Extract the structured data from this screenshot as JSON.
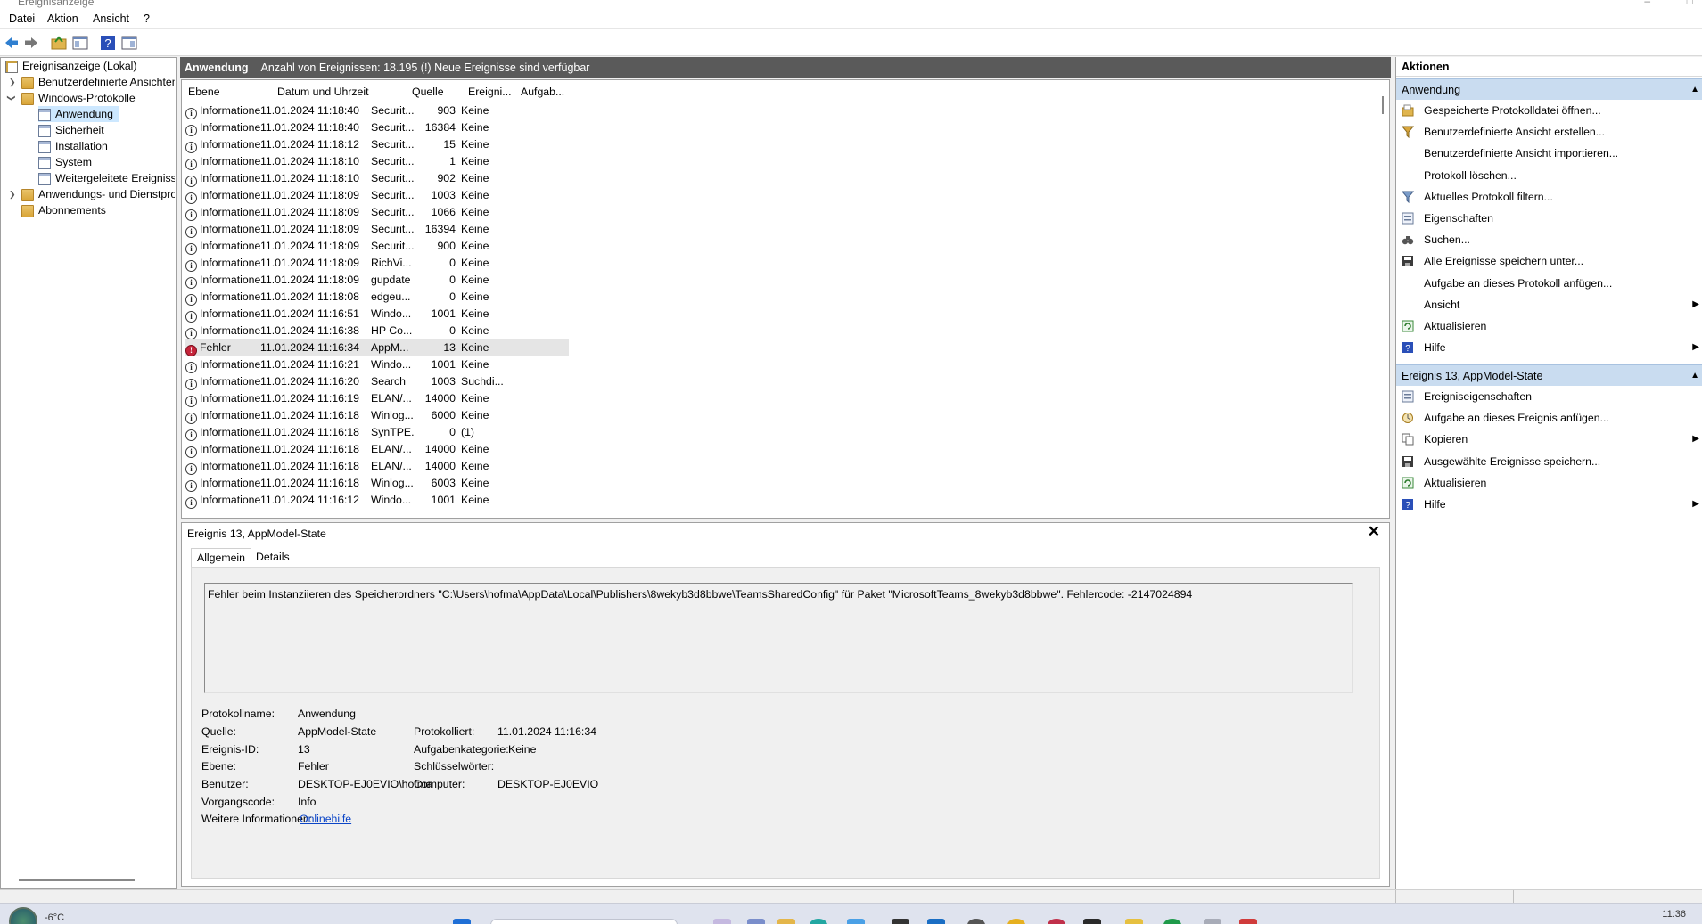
{
  "window": {
    "title": "Ereignisanzeige"
  },
  "menu": [
    "Datei",
    "Aktion",
    "Ansicht",
    "?"
  ],
  "toolbar": {
    "icons": [
      "back-arrow-icon",
      "forward-arrow-icon",
      "open-folder-icon",
      "console-tree-icon",
      "help-icon",
      "action-pane-icon"
    ]
  },
  "tree": {
    "root": "Ereignisanzeige (Lokal)",
    "items": [
      {
        "label": "Benutzerdefinierte Ansichten",
        "level": 1
      },
      {
        "label": "Windows-Protokolle",
        "level": 1
      },
      {
        "label": "Anwendung",
        "level": 2,
        "selected": true
      },
      {
        "label": "Sicherheit",
        "level": 2
      },
      {
        "label": "Installation",
        "level": 2
      },
      {
        "label": "System",
        "level": 2
      },
      {
        "label": "Weitergeleitete Ereignisse",
        "level": 2
      },
      {
        "label": "Anwendungs- und Dienstprotokolle",
        "level": 1
      },
      {
        "label": "Abonnements",
        "level": 1
      }
    ]
  },
  "log_header": {
    "name": "Anwendung",
    "info": "Anzahl von Ereignissen: 18.195 (!) Neue Ereignisse sind verfügbar"
  },
  "columns": [
    "Ebene",
    "Datum und Uhrzeit",
    "Quelle",
    "Ereigni...",
    "Aufgab..."
  ],
  "events": [
    {
      "level": "Informationen",
      "datetime": "11.01.2024 11:18:40",
      "source": "Securit...",
      "id": "903",
      "task": "Keine"
    },
    {
      "level": "Informationen",
      "datetime": "11.01.2024 11:18:40",
      "source": "Securit...",
      "id": "16384",
      "task": "Keine"
    },
    {
      "level": "Informationen",
      "datetime": "11.01.2024 11:18:12",
      "source": "Securit...",
      "id": "15",
      "task": "Keine"
    },
    {
      "level": "Informationen",
      "datetime": "11.01.2024 11:18:10",
      "source": "Securit...",
      "id": "1",
      "task": "Keine"
    },
    {
      "level": "Informationen",
      "datetime": "11.01.2024 11:18:10",
      "source": "Securit...",
      "id": "902",
      "task": "Keine"
    },
    {
      "level": "Informationen",
      "datetime": "11.01.2024 11:18:09",
      "source": "Securit...",
      "id": "1003",
      "task": "Keine"
    },
    {
      "level": "Informationen",
      "datetime": "11.01.2024 11:18:09",
      "source": "Securit...",
      "id": "1066",
      "task": "Keine"
    },
    {
      "level": "Informationen",
      "datetime": "11.01.2024 11:18:09",
      "source": "Securit...",
      "id": "16394",
      "task": "Keine"
    },
    {
      "level": "Informationen",
      "datetime": "11.01.2024 11:18:09",
      "source": "Securit...",
      "id": "900",
      "task": "Keine"
    },
    {
      "level": "Informationen",
      "datetime": "11.01.2024 11:18:09",
      "source": "RichVi...",
      "id": "0",
      "task": "Keine"
    },
    {
      "level": "Informationen",
      "datetime": "11.01.2024 11:18:09",
      "source": "gupdate",
      "id": "0",
      "task": "Keine"
    },
    {
      "level": "Informationen",
      "datetime": "11.01.2024 11:18:08",
      "source": "edgeu...",
      "id": "0",
      "task": "Keine"
    },
    {
      "level": "Informationen",
      "datetime": "11.01.2024 11:16:51",
      "source": "Windo...",
      "id": "1001",
      "task": "Keine"
    },
    {
      "level": "Informationen",
      "datetime": "11.01.2024 11:16:38",
      "source": "HP Co...",
      "id": "0",
      "task": "Keine"
    },
    {
      "level": "Fehler",
      "datetime": "11.01.2024 11:16:34",
      "source": "AppM...",
      "id": "13",
      "task": "Keine",
      "error": true
    },
    {
      "level": "Informationen",
      "datetime": "11.01.2024 11:16:21",
      "source": "Windo...",
      "id": "1001",
      "task": "Keine"
    },
    {
      "level": "Informationen",
      "datetime": "11.01.2024 11:16:20",
      "source": "Search",
      "id": "1003",
      "task": "Suchdi..."
    },
    {
      "level": "Informationen",
      "datetime": "11.01.2024 11:16:19",
      "source": "ELAN/...",
      "id": "14000",
      "task": "Keine"
    },
    {
      "level": "Informationen",
      "datetime": "11.01.2024 11:16:18",
      "source": "Winlog...",
      "id": "6000",
      "task": "Keine"
    },
    {
      "level": "Informationen",
      "datetime": "11.01.2024 11:16:18",
      "source": "SynTPE...",
      "id": "0",
      "task": "(1)"
    },
    {
      "level": "Informationen",
      "datetime": "11.01.2024 11:16:18",
      "source": "ELAN/...",
      "id": "14000",
      "task": "Keine"
    },
    {
      "level": "Informationen",
      "datetime": "11.01.2024 11:16:18",
      "source": "ELAN/...",
      "id": "14000",
      "task": "Keine"
    },
    {
      "level": "Informationen",
      "datetime": "11.01.2024 11:16:18",
      "source": "Winlog...",
      "id": "6003",
      "task": "Keine"
    },
    {
      "level": "Informationen",
      "datetime": "11.01.2024 11:16:12",
      "source": "Windo...",
      "id": "1001",
      "task": "Keine"
    }
  ],
  "detail": {
    "title": "Ereignis 13, AppModel-State",
    "tabs": [
      "Allgemein",
      "Details"
    ],
    "message": "Fehler beim Instanziieren des Speicherordners \"C:\\Users\\hofma\\AppData\\Local\\Publishers\\8wekyb3d8bbwe\\TeamsSharedConfig\" für Paket \"MicrosoftTeams_8wekyb3d8bbwe\". Fehlercode: -2147024894",
    "labels": {
      "protokollname": "Protokollname:",
      "quelle": "Quelle:",
      "ereignis_id": "Ereignis-ID:",
      "ebene": "Ebene:",
      "benutzer": "Benutzer:",
      "vorgangscode": "Vorgangscode:",
      "weitere": "Weitere Informationen:",
      "protokolliert": "Protokolliert:",
      "aufgabenkategorie": "Aufgabenkategorie:",
      "schluesselwoerter": "Schlüsselwörter:",
      "computer": "Computer:"
    },
    "values": {
      "protokollname": "Anwendung",
      "quelle": "AppModel-State",
      "ereignis_id": "13",
      "ebene": "Fehler",
      "benutzer": "DESKTOP-EJ0EVIO\\hofma",
      "vorgangscode": "Info",
      "weitere": "Onlinehilfe",
      "protokolliert": "11.01.2024 11:16:34",
      "aufgabenkategorie": "Keine",
      "schluesselwoerter": "",
      "computer": "DESKTOP-EJ0EVIO"
    }
  },
  "actions": {
    "title": "Aktionen",
    "section1": "Anwendung",
    "section1_items": [
      {
        "label": "Gespeicherte Protokolldatei öffnen...",
        "icon": "open-log-icon"
      },
      {
        "label": "Benutzerdefinierte Ansicht erstellen...",
        "icon": "filter-create-icon"
      },
      {
        "label": "Benutzerdefinierte Ansicht importieren...",
        "icon": ""
      },
      {
        "label": "Protokoll löschen...",
        "icon": ""
      },
      {
        "label": "Aktuelles Protokoll filtern...",
        "icon": "filter-icon"
      },
      {
        "label": "Eigenschaften",
        "icon": "properties-icon"
      },
      {
        "label": "Suchen...",
        "icon": "binoculars-icon"
      },
      {
        "label": "Alle Ereignisse speichern unter...",
        "icon": "save-icon"
      },
      {
        "label": "Aufgabe an dieses Protokoll anfügen...",
        "icon": ""
      },
      {
        "label": "Ansicht",
        "icon": "",
        "submenu": true
      },
      {
        "label": "Aktualisieren",
        "icon": "refresh-icon"
      },
      {
        "label": "Hilfe",
        "icon": "help-icon",
        "submenu": true
      }
    ],
    "section2": "Ereignis 13, AppModel-State",
    "section2_items": [
      {
        "label": "Ereigniseigenschaften",
        "icon": "properties-icon"
      },
      {
        "label": "Aufgabe an dieses Ereignis anfügen...",
        "icon": "task-icon"
      },
      {
        "label": "Kopieren",
        "icon": "copy-icon",
        "submenu": true
      },
      {
        "label": "Ausgewählte Ereignisse speichern...",
        "icon": "save-icon"
      },
      {
        "label": "Aktualisieren",
        "icon": "refresh-icon"
      },
      {
        "label": "Hilfe",
        "icon": "help-icon",
        "submenu": true
      }
    ]
  },
  "taskbar": {
    "temperature": "-6°C",
    "time": "11:36"
  },
  "colors": {
    "selection": "#cde8ff",
    "header_dark": "#5a5a5a",
    "section_blue": "#c9dcf0",
    "error_red": "#c5243a",
    "link": "#0b45c7"
  }
}
